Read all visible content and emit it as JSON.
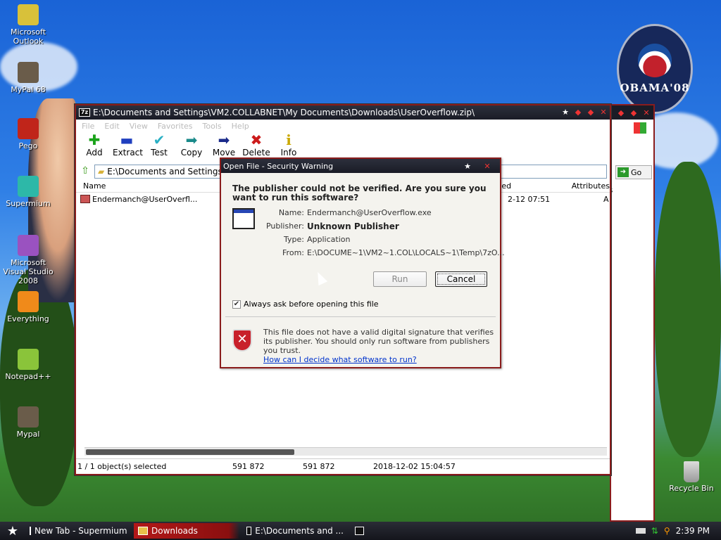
{
  "desktop": {
    "icons": [
      {
        "label": "Microsoft Outlook",
        "icon": "outlook-icon"
      },
      {
        "label": "MyPal 68",
        "icon": "raccoon-icon"
      },
      {
        "label": "Pego",
        "icon": "pego-icon"
      },
      {
        "label": "Supermium",
        "icon": "supermium-icon"
      },
      {
        "label": "Microsoft Visual Studio 2008",
        "icon": "visual-studio-icon"
      },
      {
        "label": "Everything",
        "icon": "everything-icon"
      },
      {
        "label": "Notepad++",
        "icon": "notepad-plus-icon"
      },
      {
        "label": "Mypal",
        "icon": "raccoon-icon"
      }
    ],
    "recycle_bin": "Recycle Bin",
    "logo_text": "OBAMA'08"
  },
  "window": {
    "app_icon_text": "7z",
    "title": "E:\\Documents and Settings\\VM2.COLLABNET\\My Documents\\Downloads\\UserOverflow.zip\\",
    "menu": [
      "File",
      "Edit",
      "View",
      "Favorites",
      "Tools",
      "Help"
    ],
    "toolbar": [
      {
        "label": "Add",
        "icon": "plus-icon",
        "glyph": "✚",
        "color": "#1aa31a"
      },
      {
        "label": "Extract",
        "icon": "minus-icon",
        "glyph": "▬",
        "color": "#1f3fbf"
      },
      {
        "label": "Test",
        "icon": "check-icon",
        "glyph": "✔",
        "color": "#2bb0c4"
      },
      {
        "label": "Copy",
        "icon": "copy-arrow-icon",
        "glyph": "➡",
        "color": "#1a8a8a"
      },
      {
        "label": "Move",
        "icon": "move-arrow-icon",
        "glyph": "➡",
        "color": "#1a2a8a"
      },
      {
        "label": "Delete",
        "icon": "delete-x-icon",
        "glyph": "✖",
        "color": "#cc1a1a"
      },
      {
        "label": "Info",
        "icon": "info-icon",
        "glyph": "i",
        "color": "#caa800"
      }
    ],
    "address": "E:\\Documents and Settings\\VM2.COLLABNET\\My Documents\\Downloads\\UserOverflow.zip\\",
    "columns": {
      "name": "Name",
      "modified": "ed",
      "attributes": "Attributes"
    },
    "files": [
      {
        "name": "Endermanch@UserOverfl...",
        "modified": "2-12 07:51",
        "attributes": "A"
      }
    ],
    "status": {
      "selected": "1 / 1 object(s) selected",
      "size": "591 872",
      "packed": "591 872",
      "date": "2018-12-02 15:04:57"
    }
  },
  "background_window": {
    "go_label": "Go"
  },
  "dialog": {
    "title": "Open File - Security Warning",
    "question": "The publisher could not be verified.  Are you sure you want to run this software?",
    "fields": [
      {
        "key": "Name:",
        "value": "Endermanch@UserOverflow.exe"
      },
      {
        "key": "Publisher:",
        "value": "Unknown Publisher"
      },
      {
        "key": "Type:",
        "value": "Application"
      },
      {
        "key": "From:",
        "value": "E:\\DOCUME~1\\VM2~1.COL\\LOCALS~1\\Temp\\7zO..."
      }
    ],
    "run_label": "Run",
    "cancel_label": "Cancel",
    "checkbox_label": "Always ask before opening this file",
    "checkbox_checked": true,
    "warning_text": "This file does not have a valid digital signature that verifies its publisher.  You should only run software from publishers you trust.",
    "help_link": "How can I decide what software to run?"
  },
  "taskbar": {
    "tasks": [
      {
        "label": "New Tab - Supermium",
        "icon": "supermium-icon"
      },
      {
        "label": "Downloads",
        "icon": "folder-icon"
      },
      {
        "label": "E:\\Documents and ...",
        "icon": "7zip-icon"
      },
      {
        "label": "",
        "icon": "7zip-icon"
      }
    ],
    "clock": "2:39 PM"
  },
  "colors": {
    "accent_red": "#8a1c1c",
    "title_dark": "#1a1c26"
  }
}
